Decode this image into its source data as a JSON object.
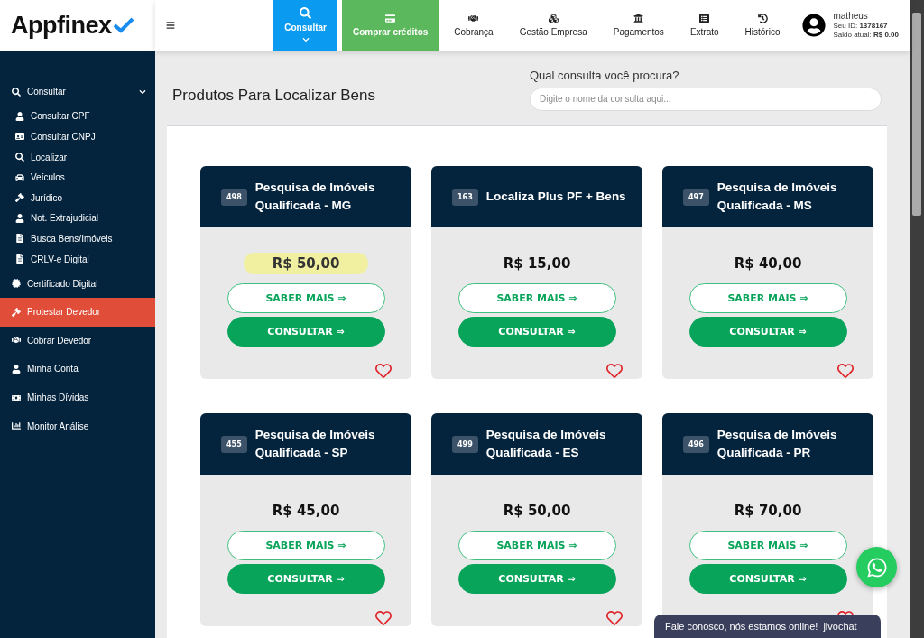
{
  "logo": {
    "text": "Appfinex"
  },
  "nav": [
    {
      "label": "Consultar",
      "kind": "tab",
      "selected": true
    },
    {
      "label": "Comprar créditos",
      "kind": "promo",
      "selected": false
    },
    {
      "label": "Cobrança",
      "kind": "tab",
      "selected": false
    },
    {
      "label": "Gestão Empresa",
      "kind": "tab",
      "selected": false
    },
    {
      "label": "Pagamentos",
      "kind": "tab",
      "selected": false
    },
    {
      "label": "Extrato",
      "kind": "tab",
      "selected": false
    },
    {
      "label": "Histórico",
      "kind": "tab",
      "selected": false
    }
  ],
  "user": {
    "name": "matheus",
    "id_label": "Seu ID:",
    "id": "1378167",
    "balance_label": "Saldo atual:",
    "balance": "R$ 0.00"
  },
  "sidebar": {
    "items": [
      {
        "label": "Consultar",
        "selected": false,
        "expanded": true,
        "children": [
          {
            "label": "Consultar CPF"
          },
          {
            "label": "Consultar CNPJ"
          },
          {
            "label": "Localizar"
          },
          {
            "label": "Veículos"
          },
          {
            "label": "Jurídico"
          },
          {
            "label": "Not. Extrajudicial"
          },
          {
            "label": "Busca Bens/Imóveis"
          },
          {
            "label": "CRLV-e Digital"
          }
        ]
      },
      {
        "label": "Certificado Digital",
        "selected": false
      },
      {
        "label": "Protestar Devedor",
        "selected": true
      },
      {
        "label": "Cobrar Devedor",
        "selected": false
      },
      {
        "label": "Minha Conta",
        "selected": false
      },
      {
        "label": "Minhas Dívidas",
        "selected": false
      },
      {
        "label": "Monitor Análise",
        "selected": false
      }
    ]
  },
  "page": {
    "title": "Produtos Para Localizar Bens",
    "search_label": "Qual consulta você procura?",
    "search": {
      "placeholder": "Digite o nome da consulta aqui..."
    }
  },
  "products": [
    {
      "code": "498",
      "name": "Pesquisa de Imóveis Qualificada - MG",
      "price": "R$ 50,00",
      "highlighted": true,
      "favorite": false,
      "more": "SABER MAIS ⇒",
      "action": "CONSULTAR ⇒"
    },
    {
      "code": "163",
      "name": "Localiza Plus PF + Bens",
      "price": "R$ 15,00",
      "highlighted": false,
      "favorite": false,
      "more": "SABER MAIS ⇒",
      "action": "CONSULTAR ⇒"
    },
    {
      "code": "497",
      "name": "Pesquisa de Imóveis Qualificada - MS",
      "price": "R$ 40,00",
      "highlighted": false,
      "favorite": false,
      "more": "SABER MAIS ⇒",
      "action": "CONSULTAR ⇒"
    },
    {
      "code": "455",
      "name": "Pesquisa de Imóveis Qualificada - SP",
      "price": "R$ 45,00",
      "highlighted": false,
      "favorite": false,
      "more": "SABER MAIS ⇒",
      "action": "CONSULTAR ⇒"
    },
    {
      "code": "499",
      "name": "Pesquisa de Imóveis Qualificada - ES",
      "price": "R$ 50,00",
      "highlighted": false,
      "favorite": false,
      "more": "SABER MAIS ⇒",
      "action": "CONSULTAR ⇒"
    },
    {
      "code": "496",
      "name": "Pesquisa de Imóveis Qualificada - PR",
      "price": "R$ 70,00",
      "highlighted": false,
      "favorite": false,
      "more": "SABER MAIS ⇒",
      "action": "CONSULTAR ⇒"
    }
  ],
  "chat": {
    "text": "Fale conosco, nós estamos online!",
    "brand": "jivochat"
  }
}
